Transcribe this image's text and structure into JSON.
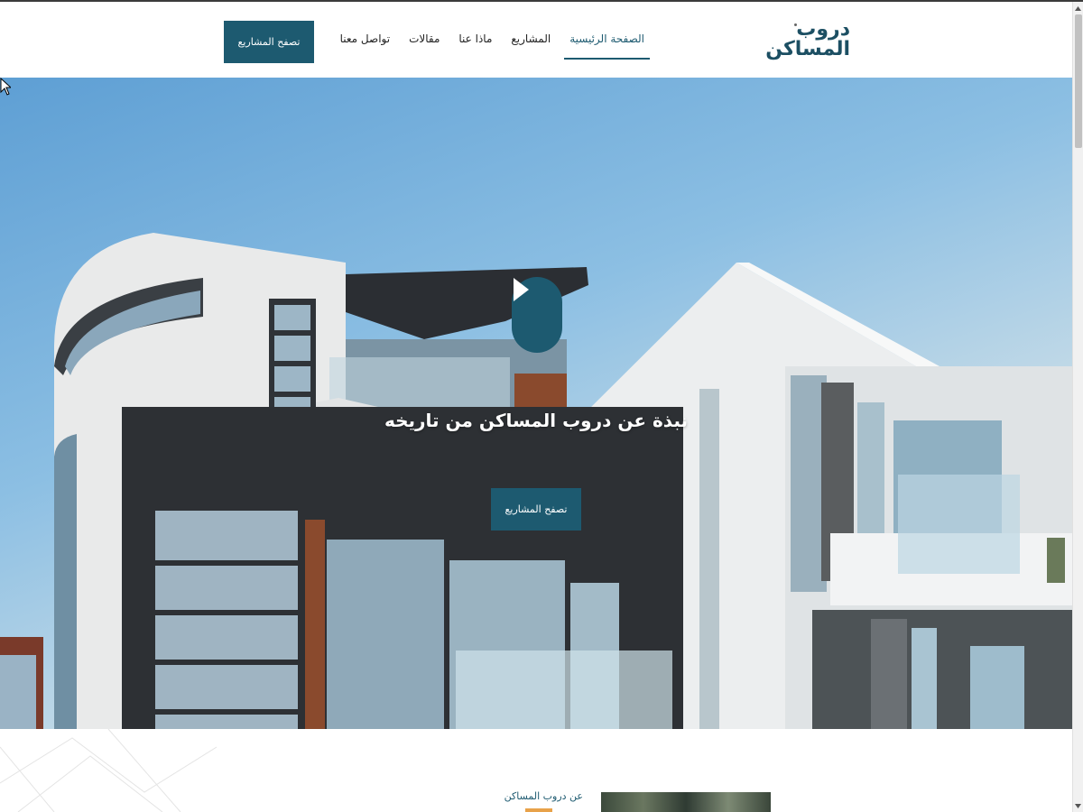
{
  "header": {
    "logo_line1": "دروب",
    "logo_line2": "المساكن",
    "nav": [
      {
        "label": "الصفحة الرئيسية",
        "active": true
      },
      {
        "label": "المشاريع",
        "active": false
      },
      {
        "label": "ماذا عنا",
        "active": false
      },
      {
        "label": "مقالات",
        "active": false
      },
      {
        "label": "تواصل معنا",
        "active": false
      }
    ],
    "cta_label": "تصفح المشاريع"
  },
  "hero": {
    "title": "نبذة عن دروب المساكن من تاريخه",
    "cta_label": "تصفح المشاريع",
    "play_icon": "play-icon"
  },
  "about": {
    "label": "عن دروب المساكن"
  },
  "colors": {
    "primary": "#1d5a70",
    "accent": "#e8a24a"
  }
}
